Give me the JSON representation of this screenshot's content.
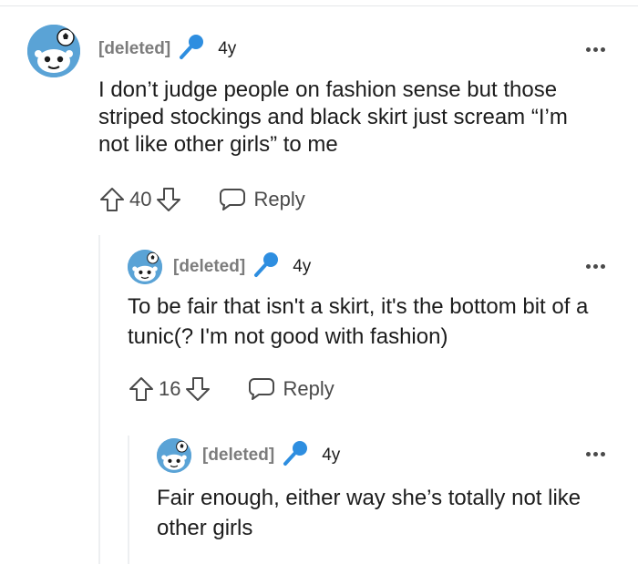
{
  "comments": [
    {
      "author": "[deleted]",
      "age": "4y",
      "body": "I don’t judge people on fashion sense but those striped stockings and black skirt just scream “I’m not like other girls” to me",
      "votes": "40",
      "reply_label": "Reply"
    },
    {
      "author": "[deleted]",
      "age": "4y",
      "body": "To be fair that isn't a skirt, it's the bottom bit of a tunic(? I'm not good with fashion)",
      "votes": "16",
      "reply_label": "Reply"
    },
    {
      "author": "[deleted]",
      "age": "4y",
      "body": "Fair enough, either way she’s totally not like other girls"
    }
  ],
  "icons": {
    "avatar": "snoo-avatar-icon",
    "badge": "microphone-icon",
    "more": "more-options-icon",
    "upvote": "upvote-arrow-icon",
    "downvote": "downvote-arrow-icon",
    "reply": "speech-bubble-icon"
  },
  "colors": {
    "badge": "#2e8ee0",
    "avatar_bg": "#5aa3d6",
    "meta_gray": "#7c7c7c"
  }
}
